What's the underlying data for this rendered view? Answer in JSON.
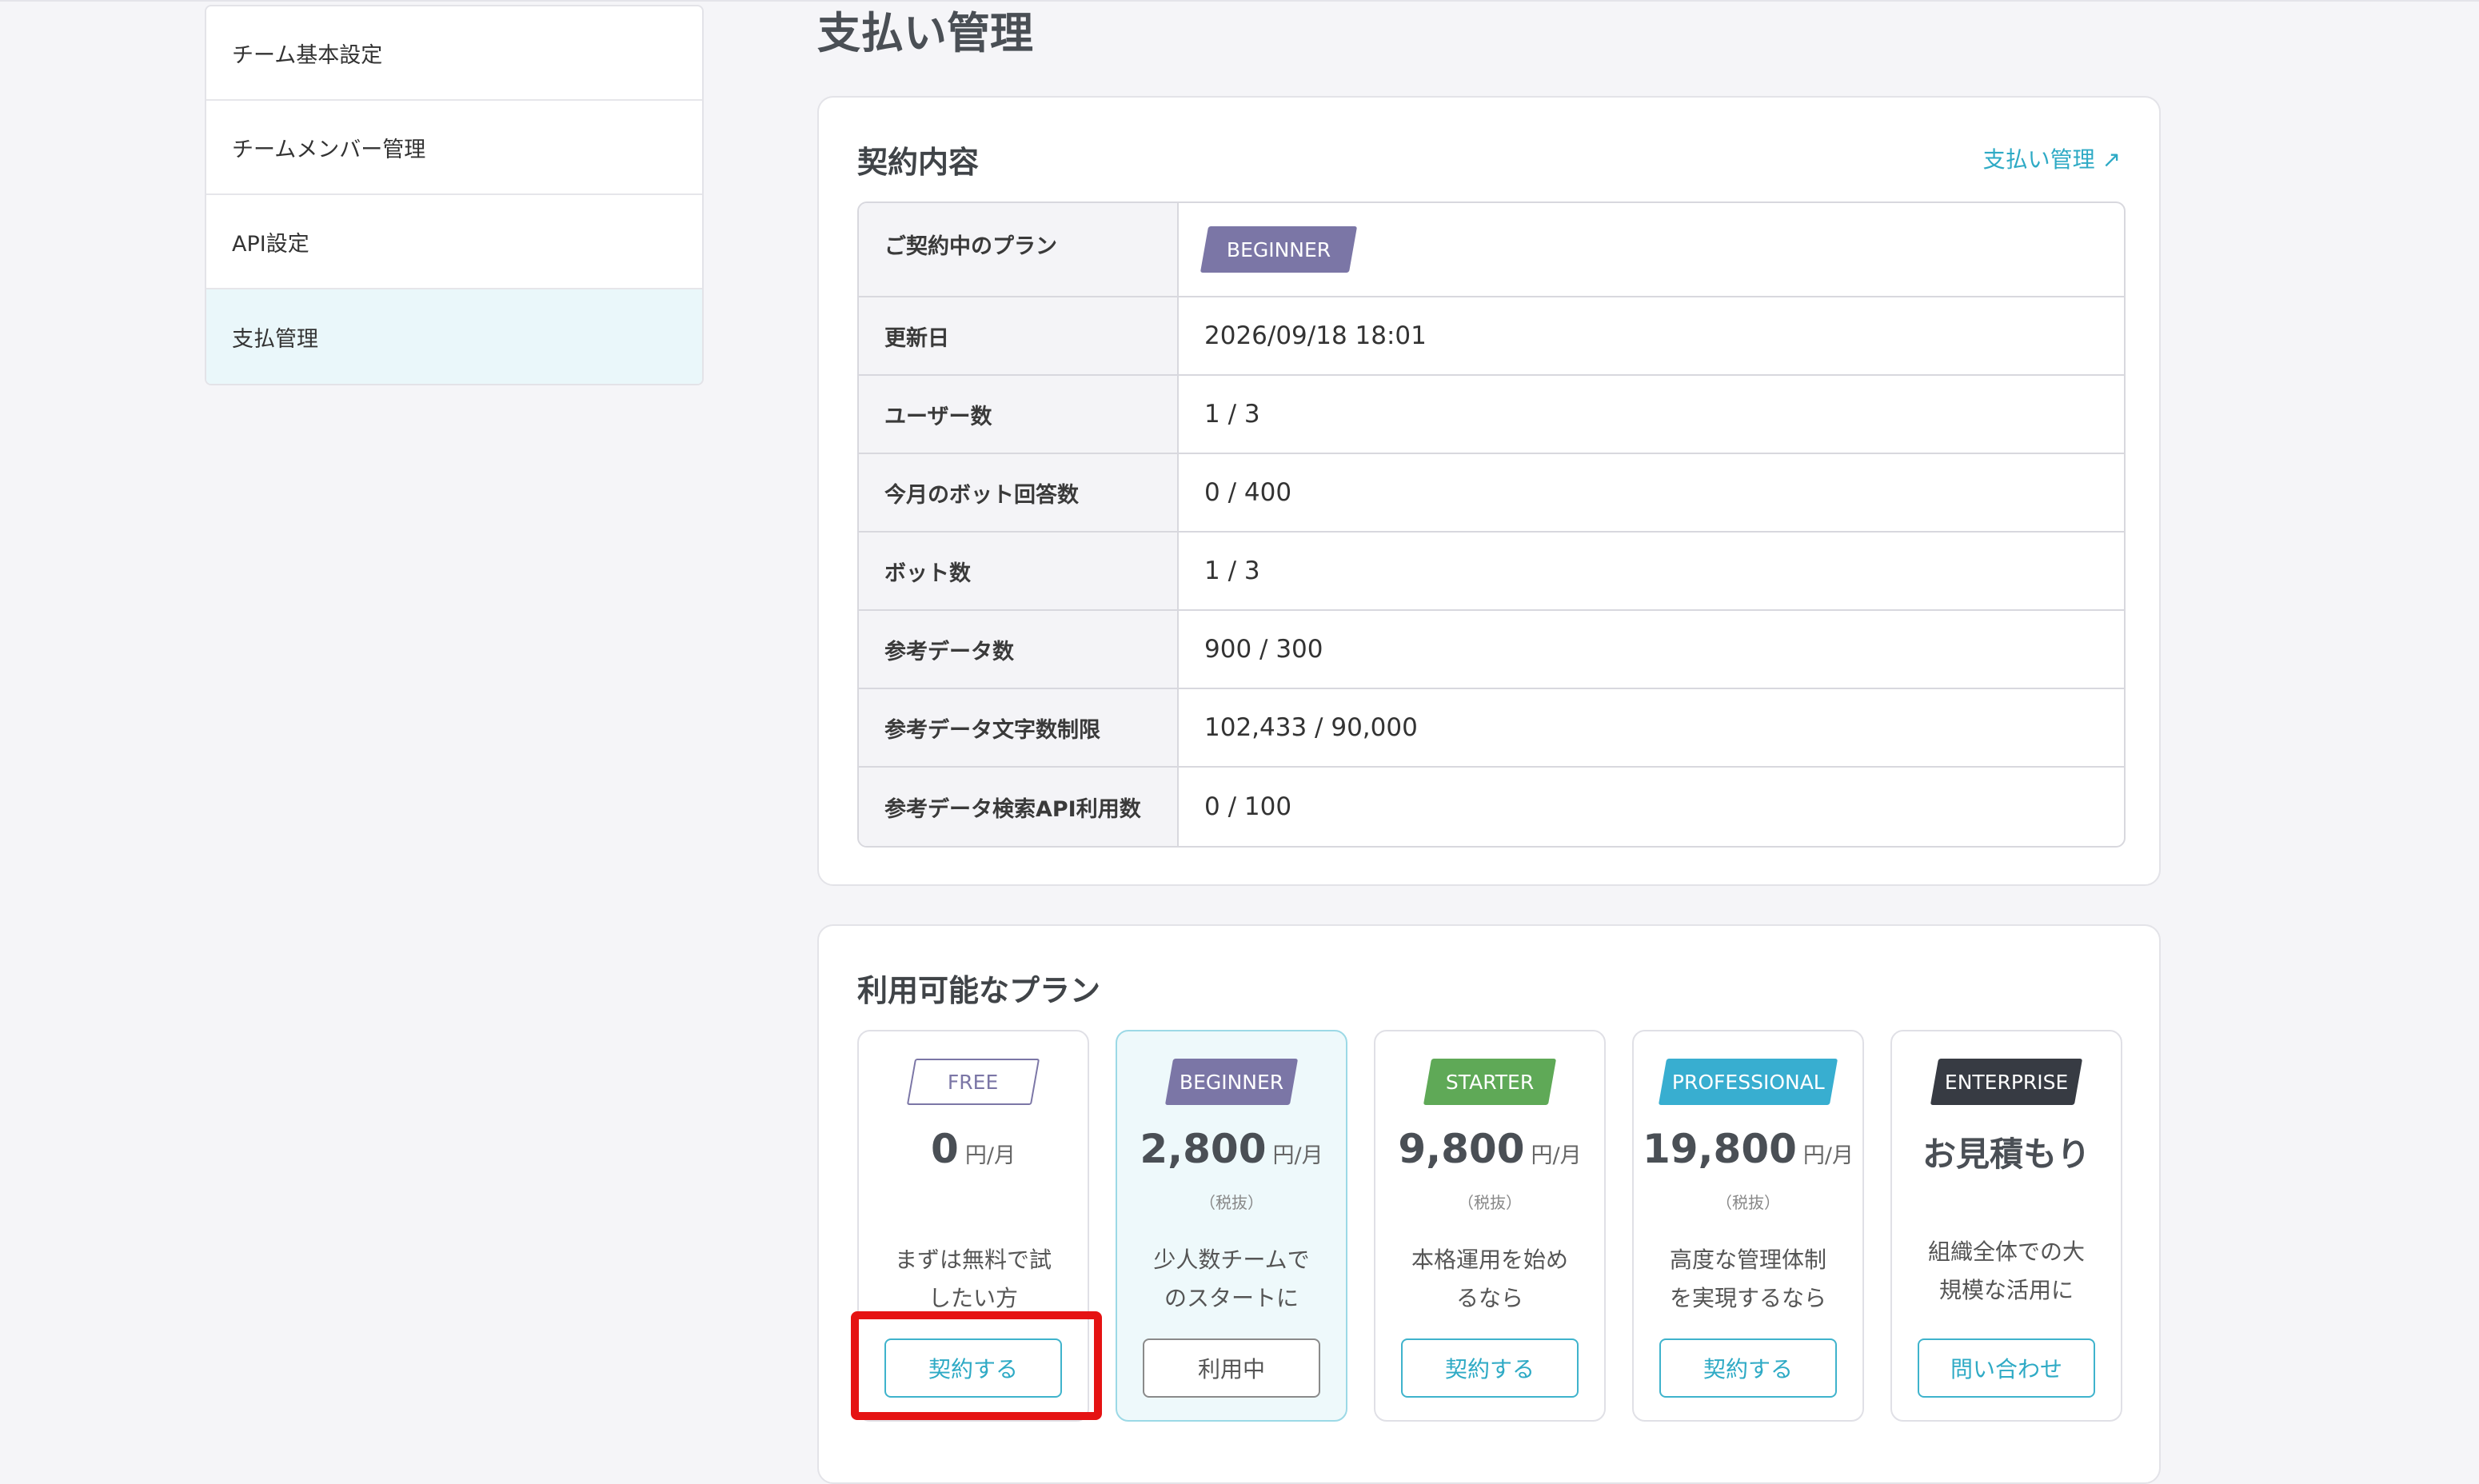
{
  "sidebar": {
    "items": [
      {
        "label": "チーム基本設定"
      },
      {
        "label": "チームメンバー管理"
      },
      {
        "label": "API設定"
      },
      {
        "label": "支払管理"
      }
    ]
  },
  "page": {
    "title": "支払い管理"
  },
  "contract": {
    "title": "契約内容",
    "link_label": "支払い管理 ↗",
    "rows": [
      {
        "label": "ご契約中のプラン",
        "value": "BEGINNER"
      },
      {
        "label": "更新日",
        "value": "2026/09/18 18:01"
      },
      {
        "label": "ユーザー数",
        "value": "1 / 3"
      },
      {
        "label": "今月のボット回答数",
        "value": "0 / 400"
      },
      {
        "label": "ボット数",
        "value": "1 / 3"
      },
      {
        "label": "参考データ数",
        "value": "900 / 300"
      },
      {
        "label": "参考データ文字数制限",
        "value": "102,433 / 90,000"
      },
      {
        "label": "参考データ検索API利用数",
        "value": "0 / 100"
      }
    ]
  },
  "plans": {
    "title": "利用可能なプラン",
    "items": [
      {
        "badge": "FREE",
        "price": "0",
        "unit": "円/月",
        "tax": "",
        "desc": "まずは無料で試したい方",
        "button": "契約する",
        "color": "#7b76a6"
      },
      {
        "badge": "BEGINNER",
        "price": "2,800",
        "unit": "円/月",
        "tax": "（税抜）",
        "desc": "少人数チームでのスタートに",
        "button": "利用中",
        "color": "#7b76a6"
      },
      {
        "badge": "STARTER",
        "price": "9,800",
        "unit": "円/月",
        "tax": "（税抜）",
        "desc": "本格運用を始めるなら",
        "button": "契約する",
        "color": "#5fa957"
      },
      {
        "badge": "PROFESSIONAL",
        "price": "19,800",
        "unit": "円/月",
        "tax": "（税抜）",
        "desc": "高度な管理体制を実現するなら",
        "button": "契約する",
        "color": "#38aed0"
      },
      {
        "badge": "ENTERPRISE",
        "quote": "お見積もり",
        "desc": "組織全体での大規模な活用に",
        "button": "問い合わせ",
        "color": "#373b43"
      }
    ]
  }
}
